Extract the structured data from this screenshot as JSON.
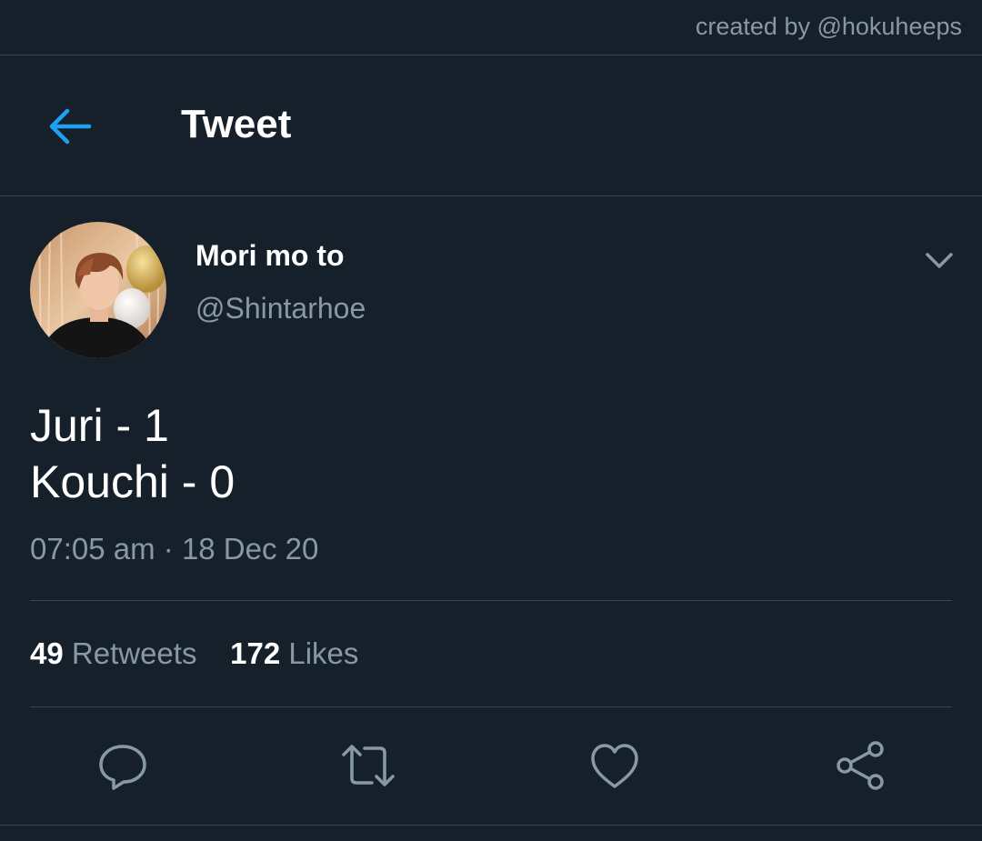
{
  "watermark": "created by @hokuheeps",
  "header": {
    "title": "Tweet",
    "back_icon": "arrow-left-icon",
    "accent_color": "#1da1f2"
  },
  "author": {
    "display_name": "Mori mo to",
    "handle": "@Shintarhoe"
  },
  "tweet": {
    "lines": [
      "Juri - 1",
      "Kouchi - 0"
    ],
    "time": "07:05 am",
    "separator": "·",
    "date": "18 Dec 20"
  },
  "stats": {
    "retweets_count": "49",
    "retweets_label": "Retweets",
    "likes_count": "172",
    "likes_label": "Likes"
  },
  "actions": [
    "reply-icon",
    "retweet-icon",
    "like-icon",
    "share-icon"
  ],
  "colors": {
    "background": "#15202b",
    "divider": "#38444d",
    "secondary_text": "#8899a6"
  }
}
